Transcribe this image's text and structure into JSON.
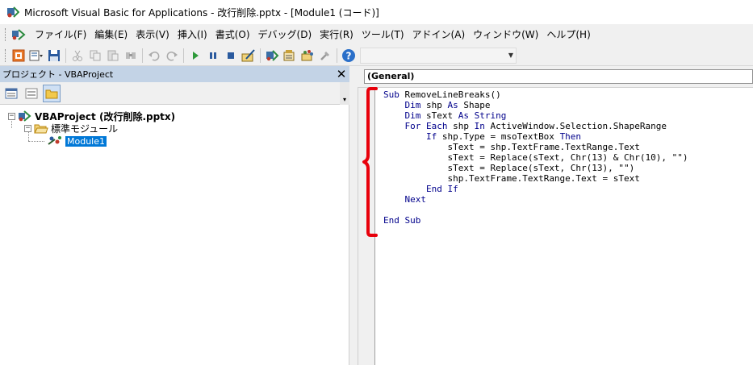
{
  "window": {
    "title": "Microsoft Visual Basic for Applications - 改行削除.pptx - [Module1 (コード)]"
  },
  "menu": {
    "items": [
      {
        "label": "ファイル(F)"
      },
      {
        "label": "編集(E)"
      },
      {
        "label": "表示(V)"
      },
      {
        "label": "挿入(I)"
      },
      {
        "label": "書式(O)"
      },
      {
        "label": "デバッグ(D)"
      },
      {
        "label": "実行(R)"
      },
      {
        "label": "ツール(T)"
      },
      {
        "label": "アドイン(A)"
      },
      {
        "label": "ウィンドウ(W)"
      },
      {
        "label": "ヘルプ(H)"
      }
    ]
  },
  "toolbar": {
    "icons": [
      "view-host-icon",
      "insert-module-icon",
      "save-icon",
      "cut-icon",
      "copy-icon",
      "paste-icon",
      "find-icon",
      "undo-icon",
      "redo-icon",
      "run-icon",
      "break-icon",
      "reset-icon",
      "design-mode-icon",
      "project-explorer-icon",
      "properties-icon",
      "object-browser-icon",
      "toolbox-icon",
      "help-icon"
    ],
    "position_combo": ""
  },
  "project_pane": {
    "title": "プロジェクト - VBAProject",
    "close_symbol": "✕",
    "tree": {
      "root_label": "VBAProject (改行削除.pptx)",
      "folder_label": "標準モジュール",
      "module_label": "Module1"
    }
  },
  "code_window": {
    "object_combo": "(General)",
    "lines": [
      {
        "indent": 0,
        "parts": [
          {
            "t": "Sub",
            "k": true
          },
          {
            "t": " RemoveLineBreaks()",
            "k": false
          }
        ]
      },
      {
        "indent": 4,
        "parts": [
          {
            "t": "Dim",
            "k": true
          },
          {
            "t": " shp ",
            "k": false
          },
          {
            "t": "As",
            "k": true
          },
          {
            "t": " Shape",
            "k": false
          }
        ]
      },
      {
        "indent": 4,
        "parts": [
          {
            "t": "Dim",
            "k": true
          },
          {
            "t": " sText ",
            "k": false
          },
          {
            "t": "As",
            "k": true
          },
          {
            "t": " ",
            "k": false
          },
          {
            "t": "String",
            "k": true
          }
        ]
      },
      {
        "indent": 4,
        "parts": [
          {
            "t": "For Each",
            "k": true
          },
          {
            "t": " shp ",
            "k": false
          },
          {
            "t": "In",
            "k": true
          },
          {
            "t": " ActiveWindow.Selection.ShapeRange",
            "k": false
          }
        ]
      },
      {
        "indent": 8,
        "parts": [
          {
            "t": "If",
            "k": true
          },
          {
            "t": " shp.Type = msoTextBox ",
            "k": false
          },
          {
            "t": "Then",
            "k": true
          }
        ]
      },
      {
        "indent": 12,
        "parts": [
          {
            "t": "sText = shp.TextFrame.TextRange.Text",
            "k": false
          }
        ]
      },
      {
        "indent": 12,
        "parts": [
          {
            "t": "sText = Replace(sText, Chr(13) & Chr(10), \"\")",
            "k": false
          }
        ]
      },
      {
        "indent": 12,
        "parts": [
          {
            "t": "sText = Replace(sText, Chr(13), \"\")",
            "k": false
          }
        ]
      },
      {
        "indent": 12,
        "parts": [
          {
            "t": "shp.TextFrame.TextRange.Text = sText",
            "k": false
          }
        ]
      },
      {
        "indent": 8,
        "parts": [
          {
            "t": "End If",
            "k": true
          }
        ]
      },
      {
        "indent": 4,
        "parts": [
          {
            "t": "Next",
            "k": true
          }
        ]
      },
      {
        "indent": 0,
        "parts": []
      },
      {
        "indent": 0,
        "parts": [
          {
            "t": "End Sub",
            "k": true
          }
        ]
      }
    ]
  },
  "colors": {
    "keyword": "#00008b",
    "annotation_brace": "#e8000b",
    "selection": "#0078d7",
    "pane_header": "#c3d3e6"
  }
}
